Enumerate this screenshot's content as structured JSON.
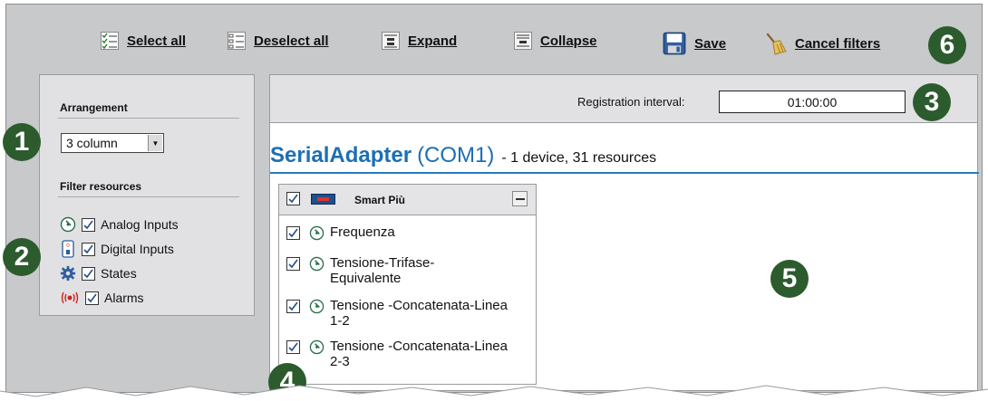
{
  "toolbar": {
    "select_all": "Select all",
    "deselect_all": "Deselect all",
    "expand": "Expand",
    "collapse": "Collapse",
    "save": "Save",
    "cancel_filters": "Cancel filters"
  },
  "callouts": [
    "1",
    "2",
    "3",
    "4",
    "5",
    "6"
  ],
  "left_panel": {
    "arrangement_title": "Arrangement",
    "arrangement_value": "3 column",
    "filter_title": "Filter resources",
    "filters": [
      {
        "label": "Analog Inputs",
        "checked": true,
        "icon": "analog-gauge-icon"
      },
      {
        "label": "Digital Inputs",
        "checked": true,
        "icon": "digital-switch-icon"
      },
      {
        "label": "States",
        "checked": true,
        "icon": "gear-icon"
      },
      {
        "label": "Alarms",
        "checked": true,
        "icon": "alarm-icon"
      }
    ]
  },
  "main": {
    "registration_label": "Registration interval:",
    "registration_value": "01:00:00",
    "adapter_name": "SerialAdapter",
    "adapter_port": "(COM1)",
    "adapter_summary": "- 1 device, 31 resources",
    "device": {
      "name": "Smart Più",
      "checked": true,
      "resources": [
        {
          "label": "Frequenza",
          "checked": true
        },
        {
          "label": "Tensione-Trifase-Equivalente",
          "checked": true
        },
        {
          "label": "Tensione -Concatenata-Linea 1-2",
          "checked": true
        },
        {
          "label": "Tensione -Concatenata-Linea 2-3",
          "checked": true
        }
      ]
    }
  },
  "colors": {
    "toolbar_bg": "#c8c9cb",
    "panel_bg": "#e1e1e3",
    "badge": "#2c5b2e",
    "adapter_blue": "#1c6fb4",
    "check_blue": "#1f4f8c"
  }
}
